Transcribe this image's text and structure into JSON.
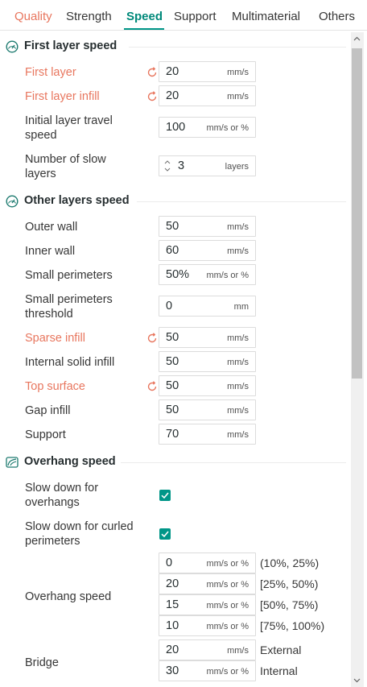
{
  "tabs": [
    {
      "label": "Quality",
      "state": "modified"
    },
    {
      "label": "Strength",
      "state": "normal"
    },
    {
      "label": "Speed",
      "state": "active"
    },
    {
      "label": "Support",
      "state": "normal"
    },
    {
      "label": "Multimaterial",
      "state": "normal"
    },
    {
      "label": "Others",
      "state": "normal"
    }
  ],
  "sections": {
    "first_layer": {
      "title": "First layer speed",
      "icon": "speedometer-icon",
      "rows": [
        {
          "label": "First layer",
          "value": "20",
          "unit": "mm/s",
          "modified": true
        },
        {
          "label": "First layer infill",
          "value": "20",
          "unit": "mm/s",
          "modified": true
        },
        {
          "label": "Initial layer travel speed",
          "value": "100",
          "unit": "mm/s or %",
          "modified": false
        },
        {
          "label": "Number of slow layers",
          "value": "3",
          "unit": "layers",
          "modified": false
        }
      ]
    },
    "other_layers": {
      "title": "Other layers speed",
      "icon": "speedometer-icon",
      "rows": [
        {
          "label": "Outer wall",
          "value": "50",
          "unit": "mm/s",
          "modified": false
        },
        {
          "label": "Inner wall",
          "value": "60",
          "unit": "mm/s",
          "modified": false
        },
        {
          "label": "Small perimeters",
          "value": "50%",
          "unit": "mm/s or %",
          "modified": false
        },
        {
          "label": "Small perimeters threshold",
          "value": "0",
          "unit": "mm",
          "modified": false
        },
        {
          "label": "Sparse infill",
          "value": "50",
          "unit": "mm/s",
          "modified": true
        },
        {
          "label": "Internal solid infill",
          "value": "50",
          "unit": "mm/s",
          "modified": false
        },
        {
          "label": "Top surface",
          "value": "50",
          "unit": "mm/s",
          "modified": true
        },
        {
          "label": "Gap infill",
          "value": "50",
          "unit": "mm/s",
          "modified": false
        },
        {
          "label": "Support",
          "value": "70",
          "unit": "mm/s",
          "modified": false
        }
      ]
    },
    "overhang": {
      "title": "Overhang speed",
      "icon": "overhang-icon",
      "checks": [
        {
          "label": "Slow down for overhangs",
          "checked": true
        },
        {
          "label": "Slow down for curled perimeters",
          "checked": true
        }
      ],
      "overhang_label": "Overhang speed",
      "overhang_rows": [
        {
          "value": "0",
          "unit": "mm/s or %",
          "range": "(10%, 25%)"
        },
        {
          "value": "20",
          "unit": "mm/s or %",
          "range": "[25%, 50%)"
        },
        {
          "value": "15",
          "unit": "mm/s or %",
          "range": "[50%, 75%)"
        },
        {
          "value": "10",
          "unit": "mm/s or %",
          "range": "[75%, 100%)"
        }
      ],
      "bridge_label": "Bridge",
      "bridge_rows": [
        {
          "value": "20",
          "unit": "mm/s",
          "note": "External"
        },
        {
          "value": "30",
          "unit": "mm/s or %",
          "note": "Internal"
        }
      ]
    }
  },
  "colors": {
    "accent": "#009688",
    "modified": "#e8765e"
  }
}
